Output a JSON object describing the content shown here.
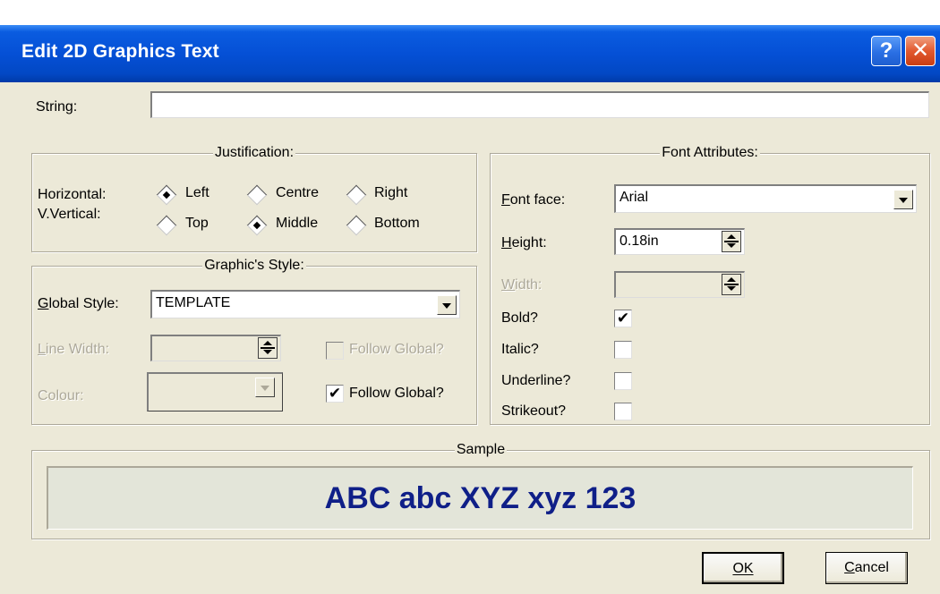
{
  "window": {
    "title": "Edit 2D Graphics Text",
    "help_glyph": "?",
    "close_glyph": "✕",
    "colors": {
      "title_bar": "#0550d6",
      "face": "#ece9d8",
      "sample_text": "#0f1f88"
    }
  },
  "string_field": {
    "label": "String:",
    "value": ""
  },
  "justification": {
    "legend": "Justification:",
    "horizontal": {
      "label": "Horizontal:",
      "options": [
        "Left",
        "Centre",
        "Right"
      ],
      "selected": "Left"
    },
    "vertical": {
      "label": "V.Vertical:",
      "options": [
        "Top",
        "Middle",
        "Bottom"
      ],
      "selected": "Middle"
    }
  },
  "graphics_style": {
    "legend": "Graphic's Style:",
    "global_style": {
      "label": "Global Style:",
      "value": "TEMPLATE"
    },
    "line_width": {
      "label": "Line Width:",
      "value": "",
      "enabled": false,
      "follow_label": "Follow Global?",
      "follow_checked": false,
      "follow_enabled": false
    },
    "colour": {
      "label": "Colour:",
      "value": "",
      "enabled": false,
      "follow_label": "Follow Global?",
      "follow_checked": true
    }
  },
  "font_attributes": {
    "legend": "Font Attributes:",
    "font_face": {
      "label": "Font face:",
      "value": "Arial"
    },
    "height": {
      "label": "Height:",
      "value": "0.18in"
    },
    "width": {
      "label": "Width:",
      "value": "",
      "enabled": false
    },
    "bold": {
      "label": "Bold?",
      "checked": true
    },
    "italic": {
      "label": "Italic?",
      "checked": false
    },
    "underline": {
      "label": "Underline?",
      "checked": false
    },
    "strikeout": {
      "label": "Strikeout?",
      "checked": false
    },
    "check_glyph": "✔"
  },
  "sample": {
    "legend": "Sample",
    "text": "ABC abc XYZ xyz 123"
  },
  "buttons": {
    "ok": "OK",
    "cancel": "Cancel"
  }
}
